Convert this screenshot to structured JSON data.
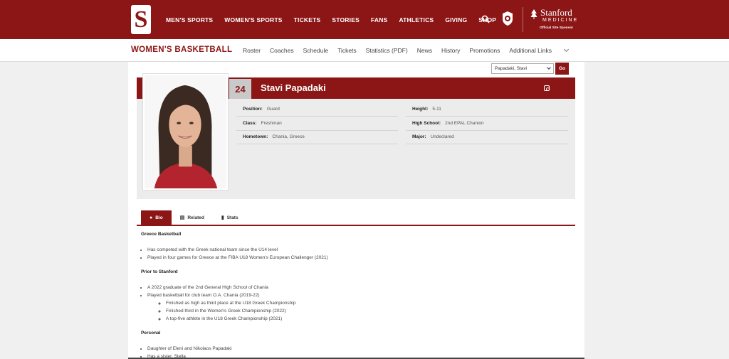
{
  "topnav": {
    "logo_letter": "S",
    "items": [
      "MEN'S SPORTS",
      "WOMEN'S SPORTS",
      "TICKETS",
      "STORIES",
      "FANS",
      "ATHLETICS",
      "GIVING",
      "SHOP"
    ],
    "sponsor": {
      "name": "Stanford",
      "sub": "MEDICINE",
      "tagline": "Official Site Sponsor"
    }
  },
  "subnav": {
    "title": "WOMEN'S BASKETBALL",
    "links": [
      "Roster",
      "Coaches",
      "Schedule",
      "Tickets",
      "Statistics (PDF)",
      "News",
      "History",
      "Promotions"
    ],
    "more_label": "Additional Links"
  },
  "player_select": {
    "selected": "Papadaki, Stavi",
    "go_label": "Go"
  },
  "player": {
    "number": "24",
    "name": "Stavi Papadaki",
    "fields": [
      {
        "label": "Position:",
        "value": "Guard"
      },
      {
        "label": "Height:",
        "value": "5-11"
      },
      {
        "label": "Class:",
        "value": "Freshman"
      },
      {
        "label": "High School:",
        "value": "2nd EPAL Chanion"
      },
      {
        "label": "Hometown:",
        "value": "Chania, Greece"
      },
      {
        "label": "Major:",
        "value": "Undeclared"
      }
    ]
  },
  "tabs": [
    "Bio",
    "Related",
    "Stats"
  ],
  "bio": {
    "sections": [
      {
        "heading": "Greece Basketball",
        "items": [
          "Has competed with the Greek national team since the U14 level",
          "Played in four games for Greece at the FIBA U18 Women's European Challenger (2021)"
        ]
      },
      {
        "heading": "Prior to Stanford",
        "items": [
          "A 2022 graduate of the 2nd General High School of Chania",
          "Played basketball for club team O.A. Chania (2019-22)"
        ],
        "subitems": [
          "Finished as high as third place at the U18 Greek Championship",
          "Finished third in the Women's Greek Championship (2022)",
          "A top-five athlete in the U18 Greek Championship (2021)"
        ]
      },
      {
        "heading": "Personal",
        "items": [
          "Daughter of Eleni and Nikolaos Papadaki",
          "Has a sister, Stella"
        ]
      }
    ]
  },
  "colors": {
    "brand": "#8c1515",
    "panel": "#ececec",
    "background": "#f0f0f0"
  }
}
